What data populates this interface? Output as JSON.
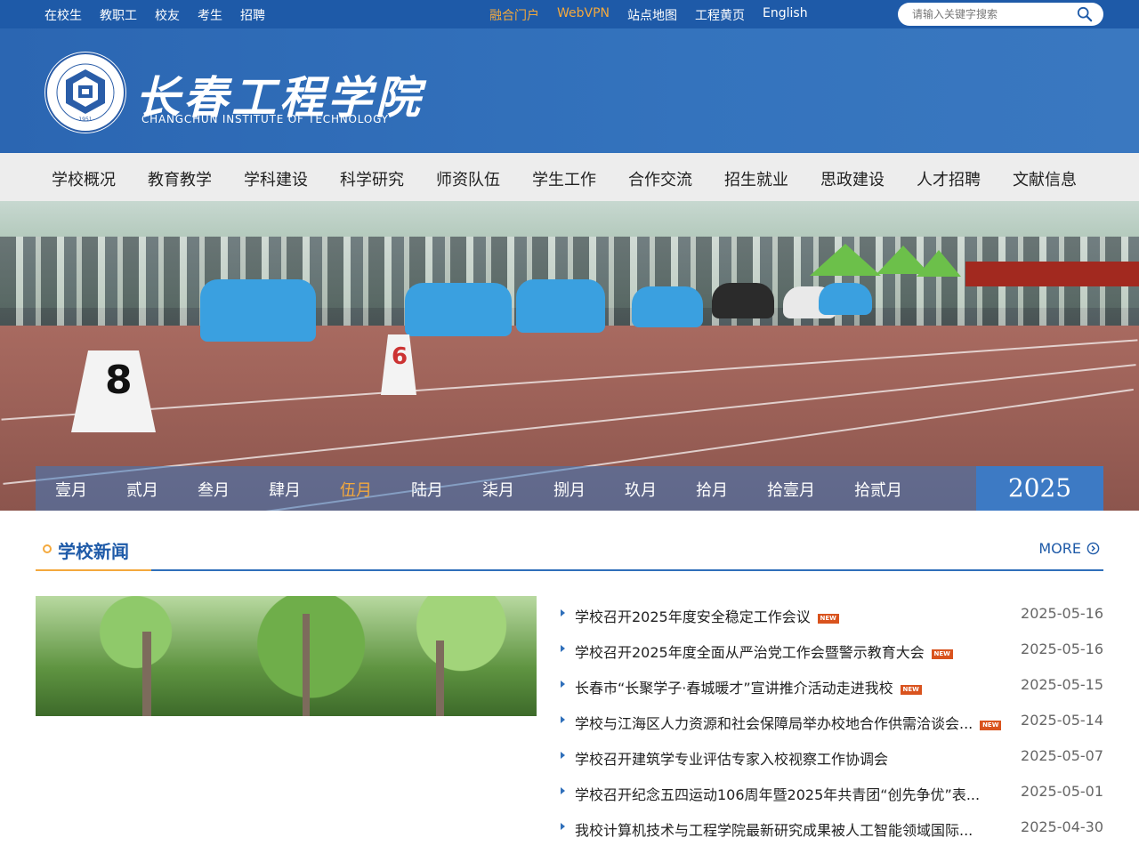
{
  "topbar": {
    "left_links": [
      "在校生",
      "教职工",
      "校友",
      "考生",
      "招聘"
    ],
    "mid_links": [
      {
        "label": "融合门户",
        "highlight": true
      },
      {
        "label": "WebVPN",
        "highlight": true
      },
      {
        "label": "站点地图",
        "highlight": false
      },
      {
        "label": "工程黄页",
        "highlight": false
      },
      {
        "label": "English",
        "highlight": false
      }
    ],
    "search_placeholder": "请输入关键字搜索"
  },
  "header": {
    "title": "长春工程学院",
    "subtitle": "CHANGCHUN INSTITUTE OF TECHNOLOGY",
    "logo_year": "1951",
    "logo_ring_text": "CHANGCHUN INSTITUTE OF TECHNOLOGY"
  },
  "nav": {
    "items": [
      "学校概况",
      "教育教学",
      "学科建设",
      "科学研究",
      "师资队伍",
      "学生工作",
      "合作交流",
      "招生就业",
      "思政建设",
      "人才招聘",
      "文献信息"
    ]
  },
  "banner": {
    "lane_numbers": [
      "8",
      "6"
    ]
  },
  "months": {
    "items": [
      "壹月",
      "贰月",
      "叁月",
      "肆月",
      "伍月",
      "陆月",
      "柒月",
      "捌月",
      "玖月",
      "拾月",
      "拾壹月",
      "拾贰月"
    ],
    "active_index": 4,
    "year": "2025"
  },
  "news": {
    "section_title": "学校新闻",
    "more_label": "MORE",
    "new_badge": "NEW",
    "items": [
      {
        "title": "学校召开2025年度安全稳定工作会议",
        "date": "2025-05-16",
        "is_new": true
      },
      {
        "title": "学校召开2025年度全面从严治党工作会暨警示教育大会",
        "date": "2025-05-16",
        "is_new": true
      },
      {
        "title": "长春市“长聚学子·春城暖才”宣讲推介活动走进我校",
        "date": "2025-05-15",
        "is_new": true
      },
      {
        "title": "学校与江海区人力资源和社会保障局举办校地合作供需洽谈会...",
        "date": "2025-05-14",
        "is_new": true
      },
      {
        "title": "学校召开建筑学专业评估专家入校视察工作协调会",
        "date": "2025-05-07",
        "is_new": false
      },
      {
        "title": "学校召开纪念五四运动106周年暨2025年共青团“创先争优”表...",
        "date": "2025-05-01",
        "is_new": false
      },
      {
        "title": "我校计算机技术与工程学院最新研究成果被人工智能领域国际...",
        "date": "2025-04-30",
        "is_new": false
      }
    ]
  },
  "colors": {
    "primary": "#1e5aa8",
    "header_bg": "#2f6fba",
    "accent": "#f4a93d",
    "new_badge": "#d9531e"
  }
}
